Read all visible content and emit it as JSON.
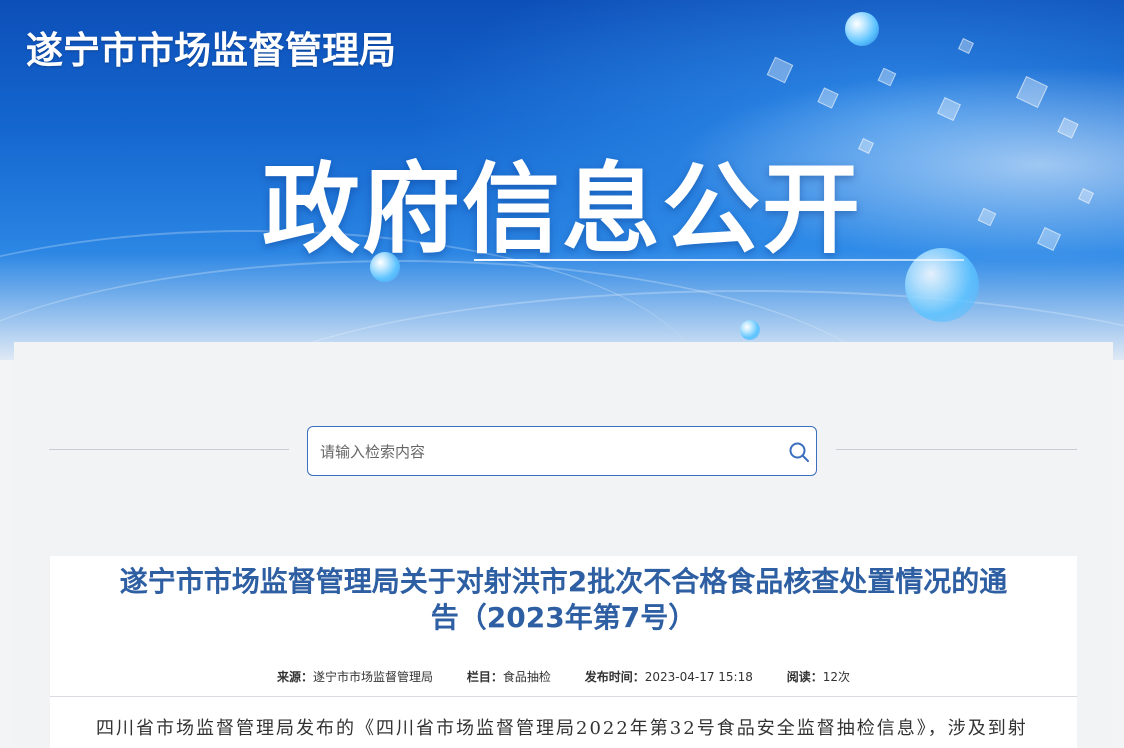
{
  "header": {
    "site_title": "遂宁市市场监督管理局",
    "banner_title": "政府信息公开"
  },
  "search": {
    "placeholder": "请输入检索内容",
    "icon": "search-icon"
  },
  "article": {
    "title_line1": "遂宁市市场监督管理局关于对射洪市2批次不合格食品核查处置情况的通",
    "title_line2": "告（2023年第7号）",
    "meta": {
      "source_label": "来源：",
      "source_value": "遂宁市市场监督管理局",
      "column_label": "栏目：",
      "column_value": "食品抽检",
      "time_label": "发布时间：",
      "time_value": "2023-04-17 15:18",
      "views_label": "阅读：",
      "views_value": "12次"
    },
    "body_first_line": "四川省市场监督管理局发布的《四川省市场监督管理局2022年第32号食品安全监督抽检信息》，涉及到射"
  },
  "colors": {
    "title_blue": "#2e5fa3",
    "search_border": "#3a6fc0",
    "banner_blue": "#1466cf"
  }
}
